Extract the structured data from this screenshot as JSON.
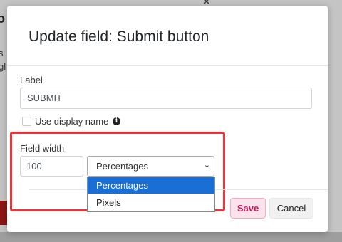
{
  "background": {
    "title_fragment": "o",
    "text_fragment_1": "s",
    "text_fragment_2": "gl",
    "close_glyph": "✕"
  },
  "modal": {
    "title": "Update field: Submit button",
    "label_caption": "Label",
    "label_value": "SUBMIT",
    "use_display_name_label": "Use display name",
    "use_display_name_checked": false,
    "info_icon_glyph": "i",
    "field_width_caption": "Field width",
    "field_width_value": "100",
    "field_width_unit_selected": "Percentages",
    "chevron_glyph": "⌄",
    "unit_options": [
      "Percentages",
      "Pixels"
    ],
    "highlighted_option": "Percentages",
    "save_label": "Save",
    "cancel_label": "Cancel"
  },
  "colors": {
    "highlight_border": "#e5343a",
    "selected_option_bg": "#1a6fd6",
    "save_bg": "#fde2ec",
    "save_text": "#c2185b"
  }
}
